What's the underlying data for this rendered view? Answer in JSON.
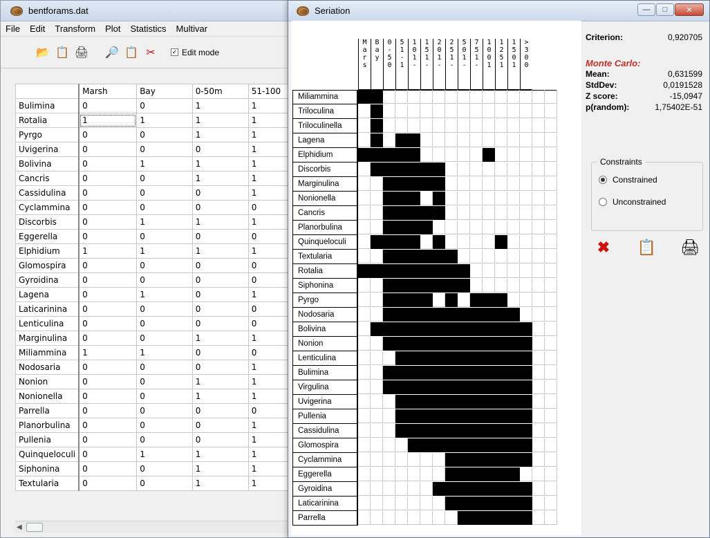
{
  "left": {
    "title": "bentforams.dat",
    "menu": [
      "File",
      "Edit",
      "Transform",
      "Plot",
      "Statistics",
      "Multivar"
    ],
    "edit_mode_label": "Edit mode",
    "columns": [
      "Marsh",
      "Bay",
      "0-50m",
      "51-100"
    ],
    "rows": [
      [
        "Bulimina",
        "0",
        "0",
        "1",
        "1"
      ],
      [
        "Rotalia",
        "1",
        "1",
        "1",
        "1"
      ],
      [
        "Pyrgo",
        "0",
        "0",
        "1",
        "1"
      ],
      [
        "Uvigerina",
        "0",
        "0",
        "0",
        "1"
      ],
      [
        "Bolivina",
        "0",
        "1",
        "1",
        "1"
      ],
      [
        "Cancris",
        "0",
        "0",
        "1",
        "1"
      ],
      [
        "Cassidulina",
        "0",
        "0",
        "0",
        "1"
      ],
      [
        "Cyclammina",
        "0",
        "0",
        "0",
        "0"
      ],
      [
        "Discorbis",
        "0",
        "1",
        "1",
        "1"
      ],
      [
        "Eggerella",
        "0",
        "0",
        "0",
        "0"
      ],
      [
        "Elphidium",
        "1",
        "1",
        "1",
        "1"
      ],
      [
        "Glomospira",
        "0",
        "0",
        "0",
        "0"
      ],
      [
        "Gyroidina",
        "0",
        "0",
        "0",
        "0"
      ],
      [
        "Lagena",
        "0",
        "1",
        "0",
        "1"
      ],
      [
        "Laticarinina",
        "0",
        "0",
        "0",
        "0"
      ],
      [
        "Lenticulina",
        "0",
        "0",
        "0",
        "0"
      ],
      [
        "Marginulina",
        "0",
        "0",
        "1",
        "1"
      ],
      [
        "Miliammina",
        "1",
        "1",
        "0",
        "0"
      ],
      [
        "Nodosaria",
        "0",
        "0",
        "0",
        "1"
      ],
      [
        "Nonion",
        "0",
        "0",
        "1",
        "1"
      ],
      [
        "Nonionella",
        "0",
        "0",
        "1",
        "1"
      ],
      [
        "Parrella",
        "0",
        "0",
        "0",
        "0"
      ],
      [
        "Planorbulina",
        "0",
        "0",
        "0",
        "1"
      ],
      [
        "Pullenia",
        "0",
        "0",
        "0",
        "1"
      ],
      [
        "Quinqueloculi",
        "0",
        "1",
        "1",
        "1"
      ],
      [
        "Siphonina",
        "0",
        "0",
        "1",
        "1"
      ],
      [
        "Textularia",
        "0",
        "0",
        "1",
        "1"
      ]
    ]
  },
  "right": {
    "title": "Seriation",
    "column_labels": [
      [
        "M",
        "a",
        "r",
        "s"
      ],
      [
        "B",
        "a",
        "y"
      ],
      [
        "0",
        "-",
        "5",
        "0"
      ],
      [
        "5",
        "1",
        "-",
        "1"
      ],
      [
        "1",
        "0",
        "1",
        "-"
      ],
      [
        "1",
        "5",
        "1",
        "-"
      ],
      [
        "2",
        "0",
        "1",
        "-"
      ],
      [
        "2",
        "5",
        "1",
        "-"
      ],
      [
        "5",
        "0",
        "1",
        "-"
      ],
      [
        "7",
        "5",
        "1",
        "-"
      ],
      [
        "1",
        "0",
        "0",
        "1"
      ],
      [
        "1",
        "2",
        "5",
        "1"
      ],
      [
        "1",
        "5",
        "0",
        "1"
      ],
      [
        ">",
        "3",
        "0",
        "0"
      ]
    ],
    "rows": [
      {
        "label": "Miliammina",
        "cells": [
          1,
          1,
          0,
          0,
          0,
          0,
          0,
          0,
          0,
          0,
          0,
          0,
          0,
          0,
          0,
          0
        ]
      },
      {
        "label": "Triloculina",
        "cells": [
          0,
          1,
          0,
          0,
          0,
          0,
          0,
          0,
          0,
          0,
          0,
          0,
          0,
          0,
          0,
          0
        ]
      },
      {
        "label": "Triloculinella",
        "cells": [
          0,
          1,
          0,
          0,
          0,
          0,
          0,
          0,
          0,
          0,
          0,
          0,
          0,
          0,
          0,
          0
        ]
      },
      {
        "label": "Lagena",
        "cells": [
          0,
          1,
          0,
          1,
          1,
          0,
          0,
          0,
          0,
          0,
          0,
          0,
          0,
          0,
          0,
          0
        ]
      },
      {
        "label": "Elphidium",
        "cells": [
          1,
          1,
          1,
          1,
          1,
          0,
          0,
          0,
          0,
          0,
          1,
          0,
          0,
          0,
          0,
          0
        ]
      },
      {
        "label": "Discorbis",
        "cells": [
          0,
          1,
          1,
          1,
          1,
          1,
          1,
          0,
          0,
          0,
          0,
          0,
          0,
          0,
          0,
          0
        ]
      },
      {
        "label": "Marginulina",
        "cells": [
          0,
          0,
          1,
          1,
          1,
          1,
          1,
          0,
          0,
          0,
          0,
          0,
          0,
          0,
          0,
          0
        ]
      },
      {
        "label": "Nonionella",
        "cells": [
          0,
          0,
          1,
          1,
          1,
          0,
          1,
          0,
          0,
          0,
          0,
          0,
          0,
          0,
          0,
          0
        ]
      },
      {
        "label": "Cancris",
        "cells": [
          0,
          0,
          1,
          1,
          1,
          1,
          1,
          0,
          0,
          0,
          0,
          0,
          0,
          0,
          0,
          0
        ]
      },
      {
        "label": "Planorbulina",
        "cells": [
          0,
          0,
          1,
          1,
          1,
          1,
          0,
          0,
          0,
          0,
          0,
          0,
          0,
          0,
          0,
          0
        ]
      },
      {
        "label": "Quinqueloculi",
        "cells": [
          0,
          1,
          1,
          1,
          1,
          0,
          1,
          0,
          0,
          0,
          0,
          1,
          0,
          0,
          0,
          0
        ]
      },
      {
        "label": "Textularia",
        "cells": [
          0,
          0,
          1,
          1,
          1,
          1,
          1,
          1,
          0,
          0,
          0,
          0,
          0,
          0,
          0,
          0
        ]
      },
      {
        "label": "Rotalia",
        "cells": [
          1,
          1,
          1,
          1,
          1,
          1,
          1,
          1,
          1,
          0,
          0,
          0,
          0,
          0,
          0,
          0
        ]
      },
      {
        "label": "Siphonina",
        "cells": [
          0,
          0,
          1,
          1,
          1,
          1,
          1,
          1,
          1,
          0,
          0,
          0,
          0,
          0,
          0,
          0
        ]
      },
      {
        "label": "Pyrgo",
        "cells": [
          0,
          0,
          1,
          1,
          1,
          1,
          0,
          1,
          0,
          1,
          1,
          1,
          0,
          0,
          0,
          0
        ]
      },
      {
        "label": "Nodosaria",
        "cells": [
          0,
          0,
          1,
          1,
          1,
          1,
          1,
          1,
          1,
          1,
          1,
          1,
          1,
          0,
          0,
          0
        ]
      },
      {
        "label": "Bolivina",
        "cells": [
          0,
          1,
          1,
          1,
          1,
          1,
          1,
          1,
          1,
          1,
          1,
          1,
          1,
          1,
          0,
          0
        ]
      },
      {
        "label": "Nonion",
        "cells": [
          0,
          0,
          1,
          1,
          1,
          1,
          1,
          1,
          1,
          1,
          1,
          1,
          1,
          1,
          0,
          0
        ]
      },
      {
        "label": "Lenticulina",
        "cells": [
          0,
          0,
          0,
          1,
          1,
          1,
          1,
          1,
          1,
          1,
          1,
          1,
          1,
          1,
          0,
          0
        ]
      },
      {
        "label": "Bulimina",
        "cells": [
          0,
          0,
          1,
          1,
          1,
          1,
          1,
          1,
          1,
          1,
          1,
          1,
          1,
          1,
          0,
          0
        ]
      },
      {
        "label": "Virgulina",
        "cells": [
          0,
          0,
          1,
          1,
          1,
          1,
          1,
          1,
          1,
          1,
          1,
          1,
          1,
          1,
          0,
          0
        ]
      },
      {
        "label": "Uvigerina",
        "cells": [
          0,
          0,
          0,
          1,
          1,
          1,
          1,
          1,
          1,
          1,
          1,
          1,
          1,
          1,
          0,
          0
        ]
      },
      {
        "label": "Pullenia",
        "cells": [
          0,
          0,
          0,
          1,
          1,
          1,
          1,
          1,
          1,
          1,
          1,
          1,
          1,
          1,
          0,
          0
        ]
      },
      {
        "label": "Cassidulina",
        "cells": [
          0,
          0,
          0,
          1,
          1,
          1,
          1,
          1,
          1,
          1,
          1,
          1,
          1,
          1,
          0,
          0
        ]
      },
      {
        "label": "Glomospira",
        "cells": [
          0,
          0,
          0,
          0,
          1,
          1,
          1,
          1,
          1,
          1,
          1,
          1,
          1,
          1,
          0,
          0
        ]
      },
      {
        "label": "Cyclammina",
        "cells": [
          0,
          0,
          0,
          0,
          0,
          0,
          0,
          1,
          1,
          1,
          1,
          1,
          1,
          1,
          0,
          0
        ]
      },
      {
        "label": "Eggerella",
        "cells": [
          0,
          0,
          0,
          0,
          0,
          0,
          0,
          1,
          1,
          1,
          1,
          1,
          1,
          0,
          0,
          0
        ]
      },
      {
        "label": "Gyroidina",
        "cells": [
          0,
          0,
          0,
          0,
          0,
          0,
          1,
          1,
          1,
          1,
          1,
          1,
          1,
          1,
          0,
          0
        ]
      },
      {
        "label": "Laticarinina",
        "cells": [
          0,
          0,
          0,
          0,
          0,
          0,
          0,
          1,
          1,
          1,
          1,
          1,
          1,
          1,
          0,
          0
        ]
      },
      {
        "label": "Parrella",
        "cells": [
          0,
          0,
          0,
          0,
          0,
          0,
          0,
          0,
          1,
          1,
          1,
          1,
          1,
          1,
          0,
          0
        ]
      }
    ],
    "criterion_label": "Criterion:",
    "criterion_value": "0,920705",
    "monte_carlo_label": "Monte Carlo:",
    "stats": [
      {
        "label": "Mean:",
        "value": "0,631599"
      },
      {
        "label": "StdDev:",
        "value": "0,0191528"
      },
      {
        "label": "Z score:",
        "value": "-15,0947"
      },
      {
        "label": "p(random):",
        "value": "1,75402E-51"
      }
    ],
    "constraints_label": "Constraints",
    "constraint_options": [
      "Constrained",
      "Unconstrained"
    ],
    "constraint_selected": "Constrained"
  }
}
